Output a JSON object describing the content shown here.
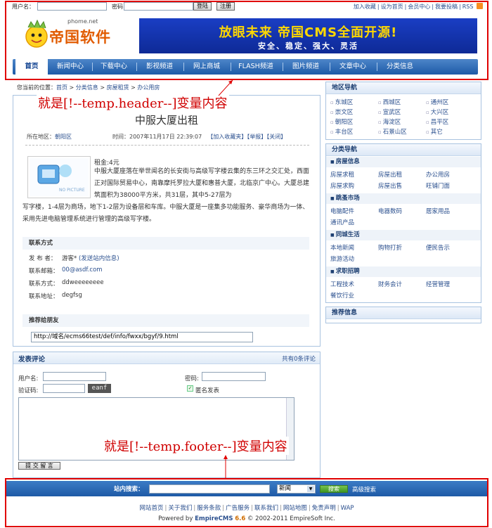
{
  "topbar": {
    "username_label": "用户名：",
    "password_label": "密码：",
    "login_button": "登陆",
    "register_button": "注册",
    "links": [
      "加入收藏",
      "设为首页",
      "会员中心",
      "我要投稿",
      "RSS"
    ]
  },
  "logo": {
    "domain": "phome.net",
    "name": "帝国软件"
  },
  "banner": {
    "line1": "放眼未来 帝国CMS全面开源!",
    "line2": "安全、稳定、强大、灵活"
  },
  "nav": {
    "items": [
      "首页",
      "新闻中心",
      "下载中心",
      "影视频道",
      "网上商城",
      "FLASH频道",
      "图片频道",
      "文章中心",
      "分类信息"
    ],
    "active": "首页"
  },
  "breadcrumb": {
    "prefix": "您当前的位置：",
    "items": [
      "首页",
      "分类信息",
      "房屋租赁",
      "办公用房"
    ],
    "separator": ">"
  },
  "annotations": {
    "header": "就是[!--temp.header--]变量内容",
    "footer": "就是[!--temp.footer--]变量内容"
  },
  "article": {
    "title": "中服大厦出租",
    "area_label": "所在地区：",
    "area_value": "朝阳区",
    "time_label": "时间：",
    "time_value": "2007年11月17日 22:39:07",
    "actions": "【加入收藏夹】【举报】【关闭】",
    "thumb_text": "NO PICTURE",
    "price": "租金:4元",
    "body_first": "中服大厦座落在举世闻名的长安街与高级写字楼云集的东三环之交汇处，西面正对国际贸易中心，南靠摩托罗拉大厦和惠普大厦，北临京广中心。大厦总建筑面积为38000平方米，共31层，其中5-27层为",
    "body_rest": "写字楼，1-4层为商场，地下1-2层为设备层和车库。中服大厦是一座集多功能服务、豪华商场为一体、采用先进电脑管理系统进行管理的高级写字楼。"
  },
  "contact": {
    "header": "联系方式",
    "rows": [
      {
        "label": "发 布 者：",
        "value": "游客*",
        "link": "(发送站内信息)"
      },
      {
        "label": "联系邮箱：",
        "value": "00@asdf.com"
      },
      {
        "label": "联系方式：",
        "value": "ddweeeeeeee"
      },
      {
        "label": "联系地址：",
        "value": "degfsg"
      }
    ]
  },
  "share": {
    "header": "推荐给朋友",
    "url": "http://域名/ecms66test/def/info/fwxx/bgyf/9.html"
  },
  "comment": {
    "header": "发表评论",
    "count_text": "共有0条评论",
    "username_label": "用户名:",
    "password_label": "密码:",
    "captcha_label": "验证码:",
    "captcha_value": "eanf",
    "anonymous_label": "匿名发表",
    "submit": "提 交 留 言"
  },
  "sidebar": {
    "region": {
      "header": "地区导航",
      "items": [
        "东城区",
        "西城区",
        "通州区",
        "崇文区",
        "宣武区",
        "大兴区",
        "朝阳区",
        "海淀区",
        "昌平区",
        "丰台区",
        "石景山区",
        "其它"
      ]
    },
    "category": {
      "header": "分类导航",
      "groups": [
        {
          "title": "房屋信息",
          "items": [
            "房屋求租",
            "房屋出租",
            "办公用房",
            "房屋求购",
            "房屋出售",
            "旺铺门面"
          ]
        },
        {
          "title": "跳蚤市场",
          "items": [
            "电脑配件",
            "电器数码",
            "居家用品",
            "通讯产品"
          ]
        },
        {
          "title": "同城生活",
          "items": [
            "本地新闻",
            "购物打折",
            "便民告示",
            "旅游活动"
          ]
        },
        {
          "title": "求职招聘",
          "items": [
            "工程技术",
            "财务会计",
            "经营管理",
            "餐饮行业"
          ]
        }
      ]
    },
    "recommend": {
      "header": "推荐信息"
    }
  },
  "footer": {
    "search_label": "站内搜索：",
    "select_value": "新闻",
    "search_button": "搜索",
    "advanced": "高级搜索",
    "links": [
      "网站首页",
      "关于我们",
      "服务条款",
      "广告服务",
      "联系我们",
      "网站地图",
      "免责声明",
      "WAP"
    ],
    "powered_prefix": "Powered by ",
    "powered_brand": "EmpireCMS",
    "powered_version": "6.6",
    "copyright": " © 2002-2011 EmpireSoft Inc."
  },
  "colors": {
    "accent": "#1d5aa7",
    "annotation": "#e00000",
    "banner_text": "#ffd800"
  }
}
